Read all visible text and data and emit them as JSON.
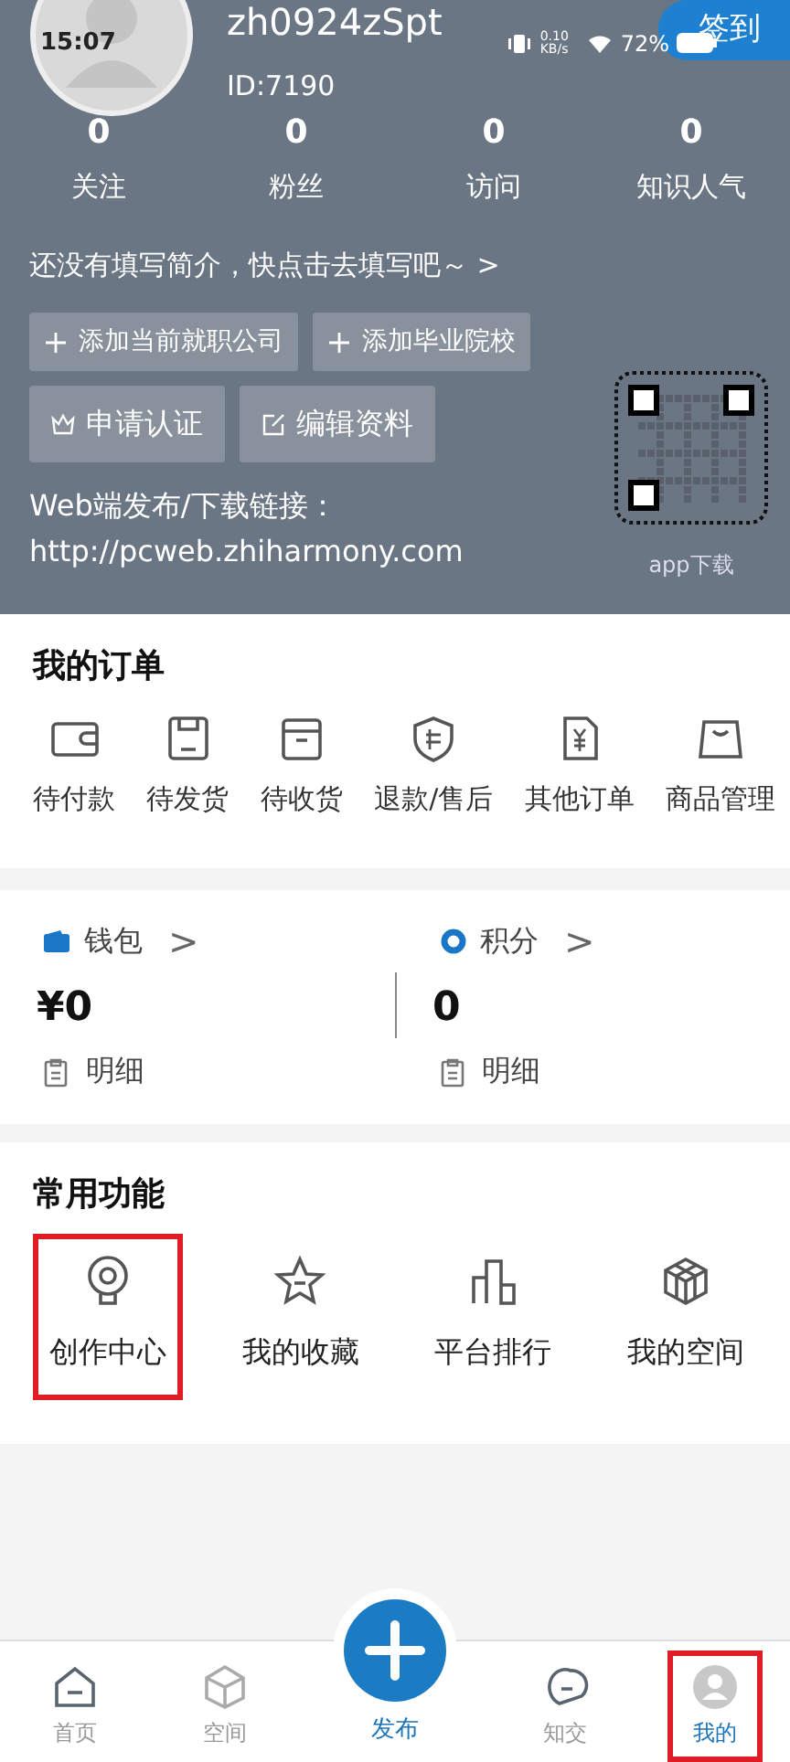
{
  "status_bar": {
    "time": "15:07",
    "speed": "0.10 KB/s",
    "battery": "72%"
  },
  "profile": {
    "username": "zh0924zSpt",
    "id": "ID:7190",
    "sign_in": "签到"
  },
  "stats": [
    {
      "value": "0",
      "label": "关注"
    },
    {
      "value": "0",
      "label": "粉丝"
    },
    {
      "value": "0",
      "label": "访问"
    },
    {
      "value": "0",
      "label": "知识人气"
    }
  ],
  "bio_prompt": "还没有填写简介，快点击去填写吧～ >",
  "profile_actions": [
    {
      "kind": "plus",
      "label": "添加当前就职公司"
    },
    {
      "kind": "plus",
      "label": "添加毕业院校"
    },
    {
      "kind": "crown",
      "label": "申请认证"
    },
    {
      "kind": "edit",
      "label": "编辑资料"
    }
  ],
  "web_link": {
    "label": "Web端发布/下载链接：",
    "url": "http://pcweb.zhiharmony.com"
  },
  "qr": {
    "caption": "app下载"
  },
  "orders": {
    "title": "我的订单",
    "items": [
      {
        "kind": "wallet",
        "label": "待付款"
      },
      {
        "kind": "floppy",
        "label": "待发货"
      },
      {
        "kind": "box",
        "label": "待收货"
      },
      {
        "kind": "shield",
        "label": "退款/售后"
      },
      {
        "kind": "receipt",
        "label": "其他订单"
      },
      {
        "kind": "bag",
        "label": "商品管理"
      }
    ]
  },
  "accounts": [
    {
      "kind": "wallet",
      "title": "钱包",
      "chevron": ">",
      "value": "¥0",
      "detail": "明细"
    },
    {
      "kind": "points",
      "title": "积分",
      "chevron": ">",
      "value": "0",
      "detail": "明细"
    }
  ],
  "functions": {
    "title": "常用功能",
    "items": [
      {
        "kind": "bulb",
        "label": "创作中心",
        "highlighted": true
      },
      {
        "kind": "star",
        "label": "我的收藏",
        "highlighted": false
      },
      {
        "kind": "chart",
        "label": "平台排行",
        "highlighted": false
      },
      {
        "kind": "cube",
        "label": "我的空间",
        "highlighted": false
      }
    ]
  },
  "tab_bar": [
    {
      "kind": "home",
      "label": "首页",
      "selected": false,
      "highlighted": false
    },
    {
      "kind": "cube",
      "label": "空间",
      "selected": false,
      "highlighted": false
    },
    {
      "kind": "publish",
      "label": "发布",
      "selected": false,
      "highlighted": false
    },
    {
      "kind": "chat",
      "label": "知交",
      "selected": false,
      "highlighted": false
    },
    {
      "kind": "avatar",
      "label": "我的",
      "selected": true,
      "highlighted": true
    }
  ]
}
